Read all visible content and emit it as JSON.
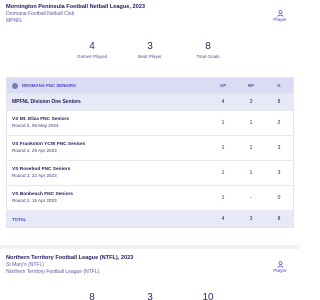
{
  "competition1": {
    "title": "Mornington Peninsula Football Netball League, 2023",
    "club": "Dromana Football Netball Club",
    "league": "MPNFL",
    "player_link": "Player",
    "stats": [
      {
        "value": "4",
        "label": "Games Played"
      },
      {
        "value": "3",
        "label": "Best Player"
      },
      {
        "value": "8",
        "label": "Total Goals"
      }
    ],
    "table": {
      "team_header": "DROMANA FNC SENIORS",
      "col_headers": [
        "GP",
        "BP",
        "G"
      ],
      "division": {
        "name": "MPFNL Division One Seniors",
        "gp": "4",
        "bp": "3",
        "g": "8"
      },
      "matches": [
        {
          "title": "VS Mt. Eliza FNC Seniors",
          "sub": "Round 5, 06 May 2023",
          "gp": "1",
          "bp": "1",
          "g": "2"
        },
        {
          "title": "VS Frankston YCW FNC Seniors",
          "sub": "Round 4, 29 Apr 2023",
          "gp": "1",
          "bp": "1",
          "g": "3"
        },
        {
          "title": "VS Rosebud FNC Seniors",
          "sub": "Round 3, 22 Apr 2023",
          "gp": "1",
          "bp": "1",
          "g": "3"
        },
        {
          "title": "VS Bonbeach FNC Seniors",
          "sub": "Round 2, 15 Apr 2023",
          "gp": "1",
          "bp": "-",
          "g": "0"
        }
      ],
      "total": {
        "label": "TOTAL",
        "gp": "4",
        "bp": "3",
        "g": "8"
      }
    }
  },
  "competition2": {
    "title": "Northern Territory Football League (NTFL), 2023",
    "club": "St Mary's (NTFL)",
    "league": "Northern Territory Football League (NTFL)",
    "player_link": "Player",
    "stats": [
      {
        "value": "8"
      },
      {
        "value": "3"
      },
      {
        "value": "10"
      }
    ]
  },
  "colors": {
    "accent": "#4a44c4",
    "header_bg": "#dadcf3",
    "row_bg": "#e8e9f7",
    "text": "#1e1b5c"
  },
  "icons": {
    "player": "person-icon",
    "club": "club-logo-icon"
  }
}
